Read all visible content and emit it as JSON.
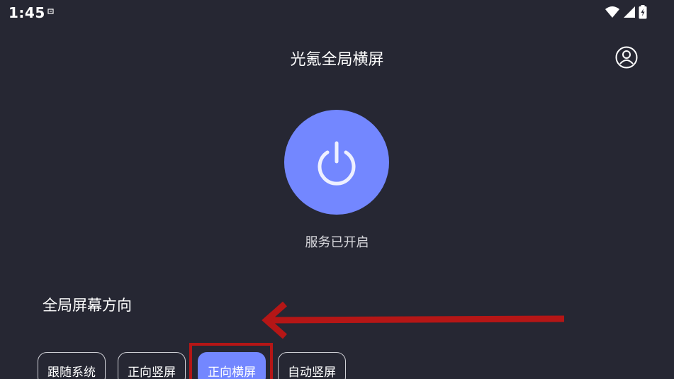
{
  "status_bar": {
    "time": "1:45",
    "icons": [
      "notification-icon",
      "wifi-icon",
      "cell-signal-icon",
      "battery-charging-icon"
    ]
  },
  "header": {
    "title": "光氪全局横屏",
    "account_icon": "account-circle-icon"
  },
  "power": {
    "icon": "power-icon",
    "status": "服务已开启",
    "color": "#7387ff"
  },
  "orientation": {
    "title": "全局屏幕方向",
    "options": [
      "跟随系统",
      "正向竖屏",
      "正向横屏",
      "自动竖屏"
    ],
    "selected": "正向横屏"
  },
  "annotation": {
    "arrow_color": "#b51616",
    "highlight": "正向横屏"
  }
}
